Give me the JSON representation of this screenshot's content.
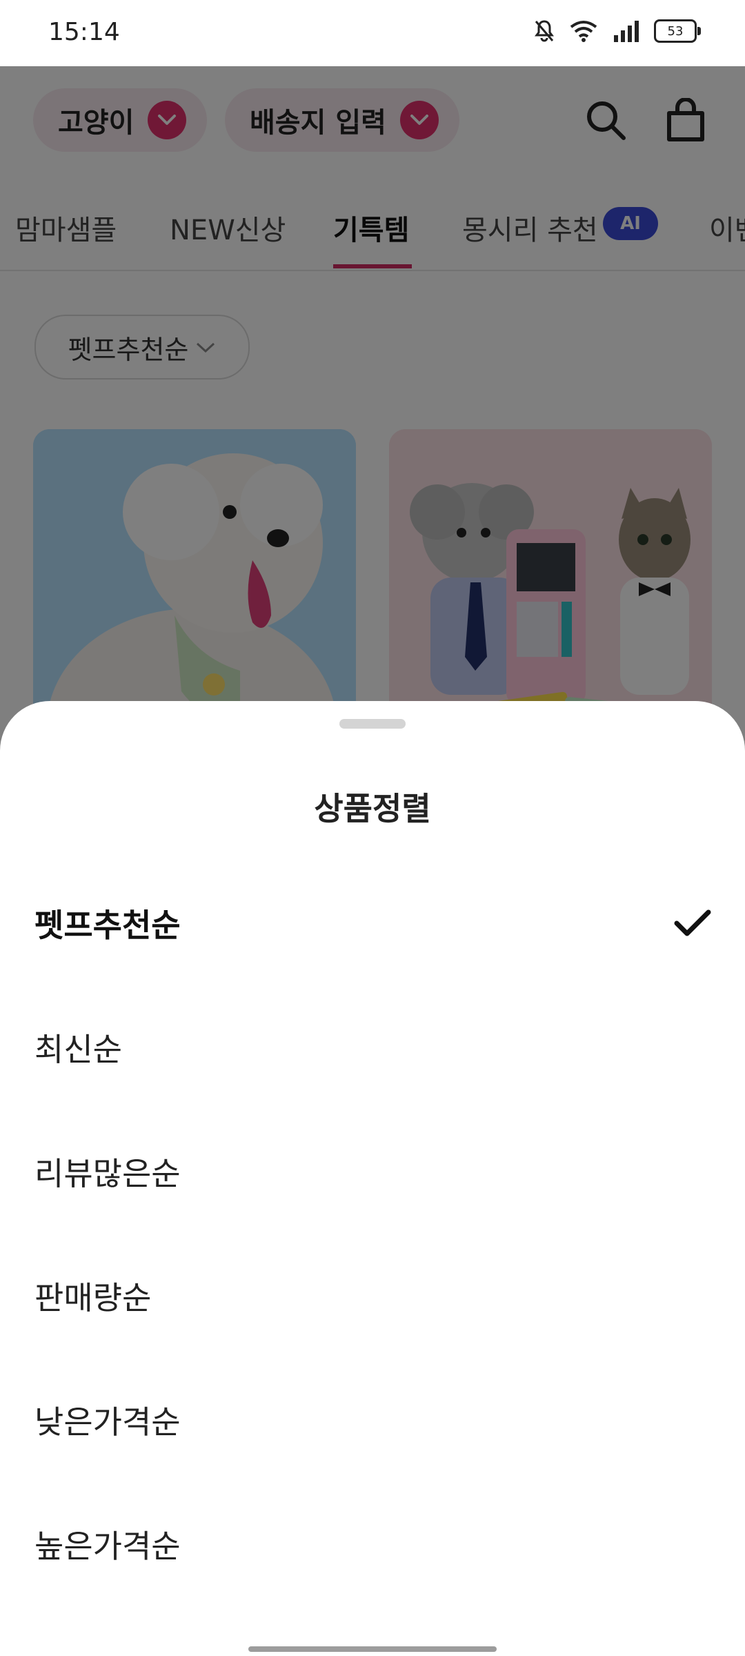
{
  "status_bar": {
    "time": "15:14",
    "battery": "53",
    "icons": [
      "bell-muted-icon",
      "wifi-icon",
      "signal-icon",
      "battery-icon"
    ]
  },
  "header": {
    "pet_selector": "고양이",
    "address_selector": "배송지 입력",
    "icons": [
      "search-icon",
      "shopping-bag-icon"
    ]
  },
  "tabs": {
    "items": [
      "맘마샘플",
      "NEW신상",
      "기특템",
      "몽시리 추천",
      "이벤"
    ],
    "active": "기특템",
    "ai_badge": "AI"
  },
  "sort_chip": {
    "label": "펫프추천순"
  },
  "products": [
    {
      "image": "white poodle with green bib on blue background"
    },
    {
      "image": "dog and cat in outfits with toy ATM on pink background"
    }
  ],
  "sort_sheet": {
    "title": "상품정렬",
    "options": [
      "펫프추천순",
      "최신순",
      "리뷰많은순",
      "판매량순",
      "낮은가격순",
      "높은가격순"
    ],
    "selected": "펫프추천순"
  },
  "colors": {
    "accent": "#e0306c",
    "tab_underline": "#d02a63",
    "ai_badge": "#3a4bd6",
    "scrim": "rgba(0,0,0,0.5)"
  }
}
